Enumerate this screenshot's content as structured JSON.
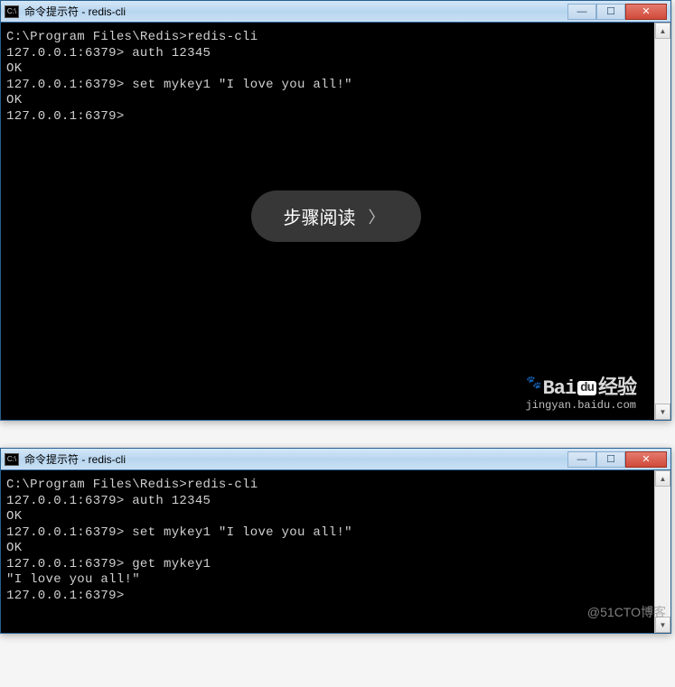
{
  "window1": {
    "title": "命令提示符 - redis-cli",
    "lines": [
      "C:\\Program Files\\Redis>redis-cli",
      "127.0.0.1:6379> auth 12345",
      "OK",
      "127.0.0.1:6379> set mykey1 \"I love you all!\"",
      "OK",
      "127.0.0.1:6379>"
    ]
  },
  "window2": {
    "title": "命令提示符 - redis-cli",
    "lines": [
      "C:\\Program Files\\Redis>redis-cli",
      "127.0.0.1:6379> auth 12345",
      "OK",
      "127.0.0.1:6379> set mykey1 \"I love you all!\"",
      "OK",
      "127.0.0.1:6379> get mykey1",
      "\"I love you all!\"",
      "127.0.0.1:6379>"
    ]
  },
  "overlay": {
    "label": "步骤阅读"
  },
  "watermark_baidu": {
    "brand_prefix": "Bai",
    "brand_du": "du",
    "brand_suffix": "经验",
    "url": "jingyan.baidu.com"
  },
  "watermark_51cto": "@51CTO博客",
  "controls": {
    "minimize": "—",
    "maximize": "☐",
    "close": "✕",
    "scroll_up": "▲",
    "scroll_down": "▼"
  }
}
